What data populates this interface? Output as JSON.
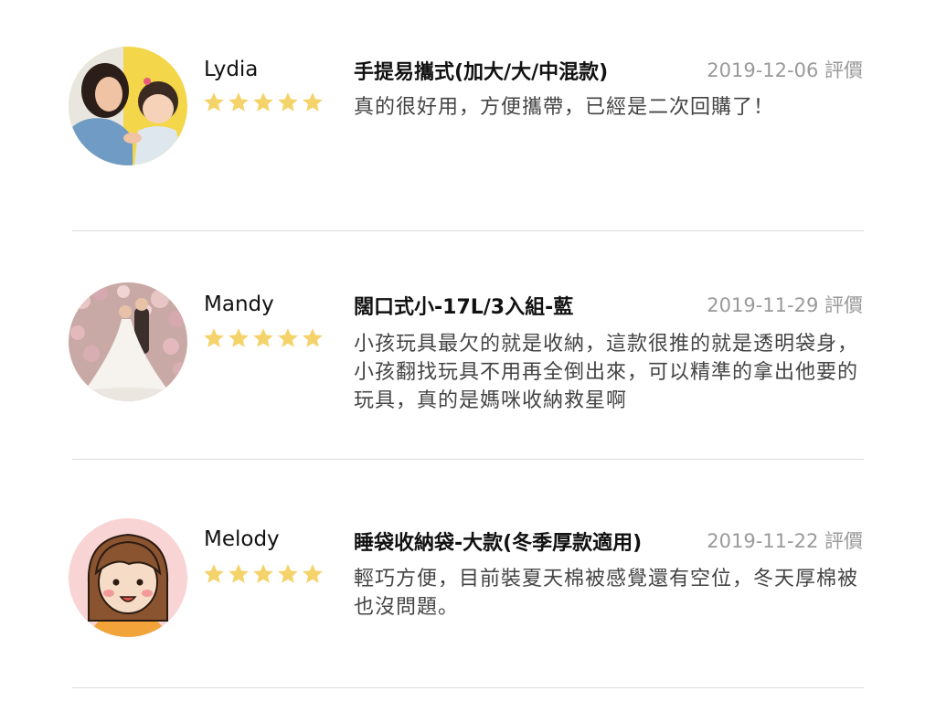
{
  "colors": {
    "star": "#f5d36b",
    "date": "#9a9a9a",
    "divider": "#dddddd",
    "avatar_bg_yellow": "#f4d64a",
    "avatar_bg_pink": "#f8d4d4"
  },
  "reviews": [
    {
      "reviewer": "Lydia",
      "rating": 5,
      "product": "手提易攜式(加大/大/中混款)",
      "date": "2019-12-06 評價",
      "comment": "真的很好用，方便攜帶，已經是二次回購了！",
      "avatar": "mother-and-baby-photo"
    },
    {
      "reviewer": "Mandy",
      "rating": 5,
      "product": "闊口式小-17L/3入組-藍",
      "date": "2019-11-29 評價",
      "comment": "小孩玩具最欠的就是收納，這款很推的就是透明袋身，小孩翻找玩具不用再全倒出來，可以精準的拿出他要的玩具，真的是媽咪收納救星啊",
      "avatar": "wedding-photo"
    },
    {
      "reviewer": "Melody",
      "rating": 5,
      "product": "睡袋收納袋-大款(冬季厚款適用)",
      "date": "2019-11-22 評價",
      "comment": "輕巧方便，目前裝夏天棉被感覺還有空位，冬天厚棉被也沒問題。",
      "avatar": "cartoon-girl-illustration"
    }
  ]
}
